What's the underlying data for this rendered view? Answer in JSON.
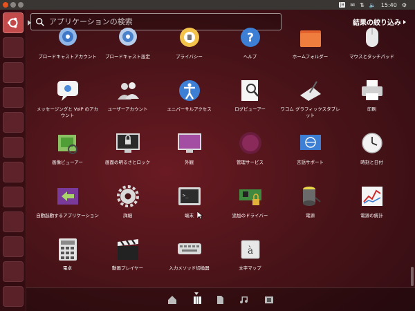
{
  "top_panel": {
    "keyboard_indicator": "ja",
    "clock": "15:40"
  },
  "search": {
    "placeholder": "アプリケーションの検索",
    "filter_label": "結果の絞り込み"
  },
  "apps": [
    {
      "label": "ブロードキャストアカウント",
      "icon": "broadcast-accounts-icon"
    },
    {
      "label": "ブロードキャスト設定",
      "icon": "broadcast-settings-icon"
    },
    {
      "label": "プライバシー",
      "icon": "privacy-icon"
    },
    {
      "label": "ヘルプ",
      "icon": "help-icon"
    },
    {
      "label": "ホームフォルダー",
      "icon": "home-folder-icon"
    },
    {
      "label": "マウスとタッチパッド",
      "icon": "mouse-icon"
    },
    {
      "label": "メッセージングと VoIP のアカウント",
      "icon": "messaging-icon"
    },
    {
      "label": "ユーザーアカウント",
      "icon": "users-icon"
    },
    {
      "label": "ユニバーサルアクセス",
      "icon": "universal-access-icon"
    },
    {
      "label": "ログビューアー",
      "icon": "log-viewer-icon"
    },
    {
      "label": "ワコム グラフィックスタブレット",
      "icon": "tablet-icon"
    },
    {
      "label": "印刷",
      "icon": "printer-icon"
    },
    {
      "label": "画像ビューアー",
      "icon": "image-viewer-icon"
    },
    {
      "label": "画面の明るさとロック",
      "icon": "brightness-lock-icon"
    },
    {
      "label": "外観",
      "icon": "appearance-icon"
    },
    {
      "label": "管理サービス",
      "icon": "management-service-icon"
    },
    {
      "label": "言語サポート",
      "icon": "language-support-icon"
    },
    {
      "label": "時刻と日付",
      "icon": "clock-icon"
    },
    {
      "label": "自動起動するアプリケーション",
      "icon": "startup-apps-icon"
    },
    {
      "label": "詳細",
      "icon": "details-gear-icon"
    },
    {
      "label": "端末",
      "icon": "terminal-icon"
    },
    {
      "label": "追加のドライバー",
      "icon": "drivers-icon"
    },
    {
      "label": "電源",
      "icon": "power-icon"
    },
    {
      "label": "電源の統計",
      "icon": "power-statistics-icon"
    },
    {
      "label": "電卓",
      "icon": "calculator-icon"
    },
    {
      "label": "動画プレイヤー",
      "icon": "video-player-icon"
    },
    {
      "label": "入力メソッド切換器",
      "icon": "input-method-icon"
    },
    {
      "label": "文字マップ",
      "icon": "character-map-icon"
    }
  ],
  "lenses": [
    "home-lens",
    "applications-lens",
    "files-lens",
    "music-lens",
    "video-lens"
  ],
  "colors": {
    "accent": "#c34a4a",
    "background": "#4b1419"
  }
}
